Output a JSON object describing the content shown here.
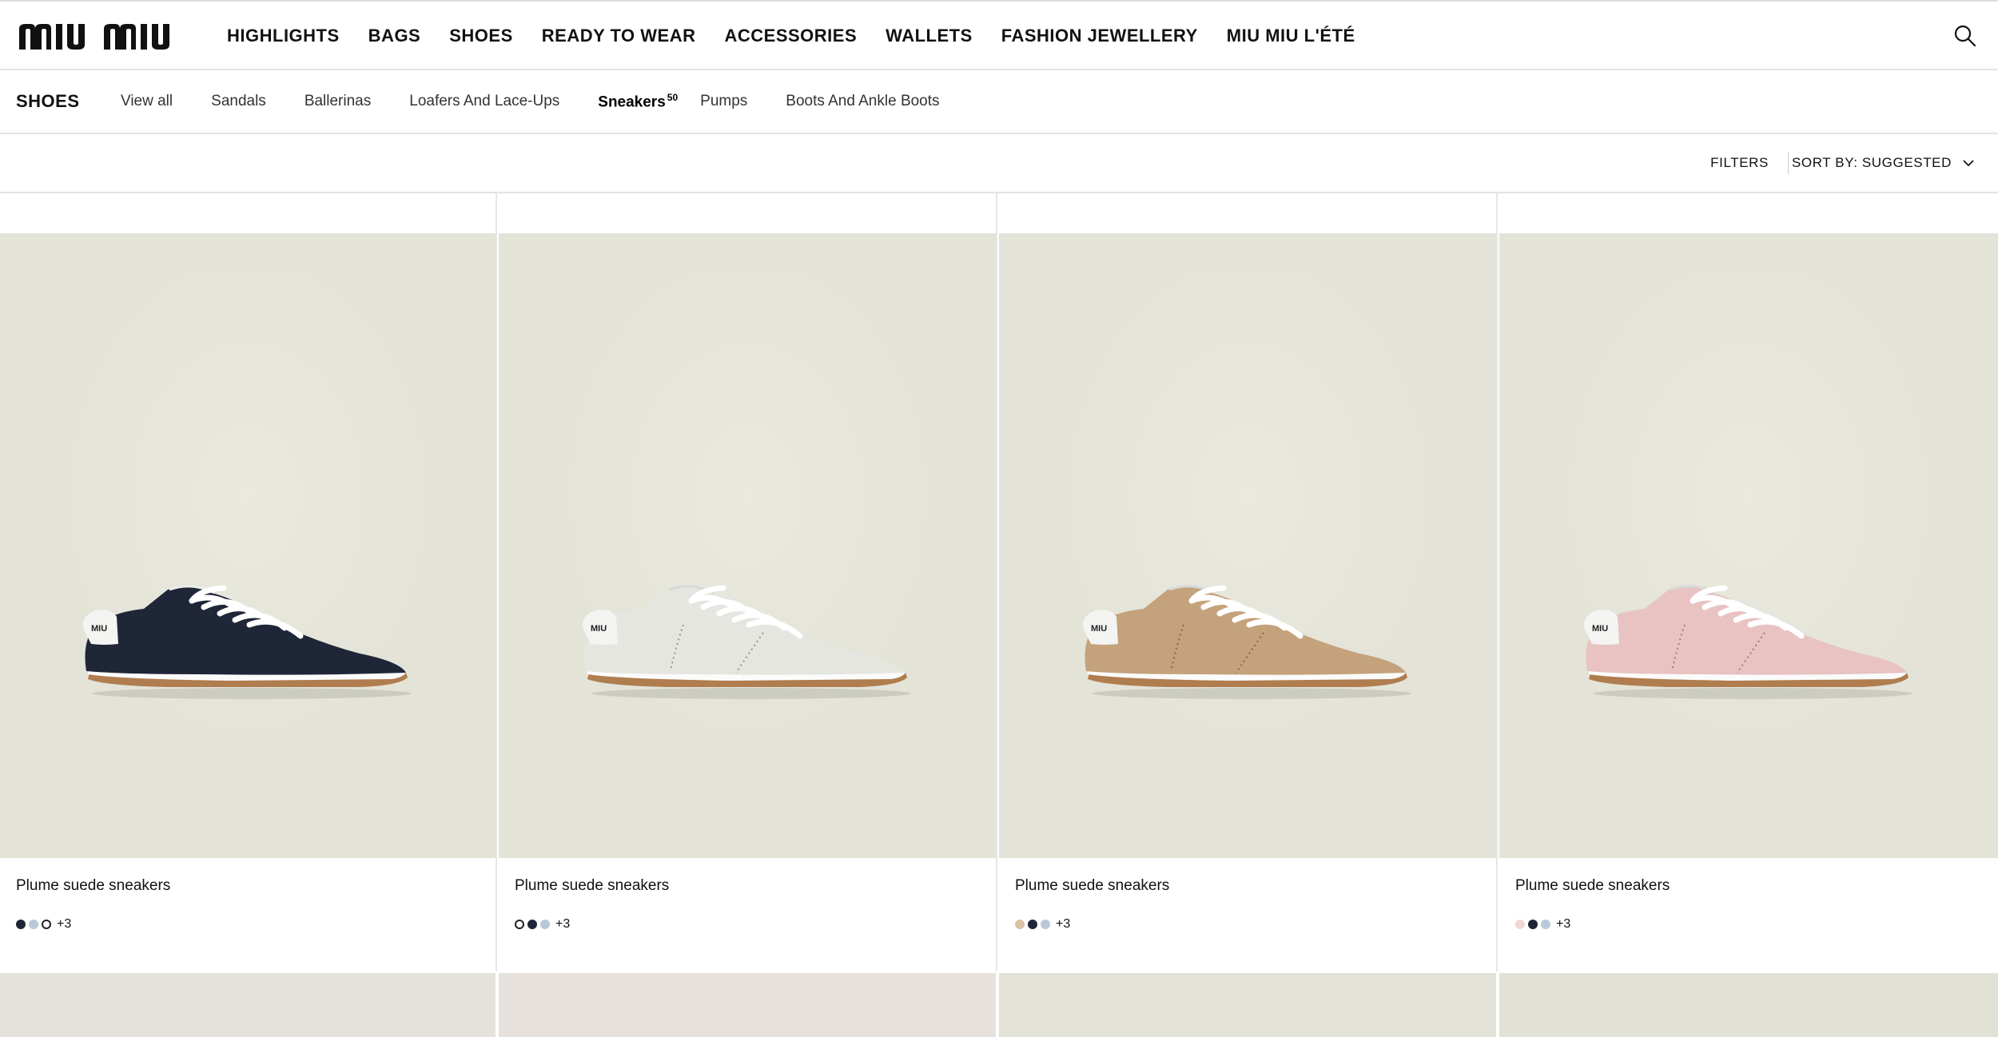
{
  "header": {
    "logo_text": "MIU MIU",
    "nav": [
      "HIGHLIGHTS",
      "BAGS",
      "SHOES",
      "READY TO WEAR",
      "ACCESSORIES",
      "WALLETS",
      "FASHION JEWELLERY",
      "MIU MIU L'ÉTÉ"
    ],
    "search_icon": "search-icon"
  },
  "subnav": {
    "title": "SHOES",
    "items": [
      "View all",
      "Sandals",
      "Ballerinas",
      "Loafers And Lace-Ups",
      "Sneakers",
      "Pumps",
      "Boots And Ankle Boots"
    ],
    "active_item": "Sneakers",
    "active_count": "50"
  },
  "toolbar": {
    "filters_label": "FILTERS",
    "sort_label": "SORT BY: SUGGESTED"
  },
  "products": [
    {
      "name": "Plume suede sneakers",
      "more": "+3",
      "shoe_color": "#1f2638",
      "swatches": [
        "#1f2638",
        "#b9c9d6",
        "ring"
      ]
    },
    {
      "name": "Plume suede sneakers",
      "more": "+3",
      "shoe_color": "#e4e6df",
      "swatches": [
        "ring",
        "#1f2638",
        "#b9c9d6"
      ]
    },
    {
      "name": "Plume suede sneakers",
      "more": "+3",
      "shoe_color": "#c4a27b",
      "swatches": [
        "#d9c2a5",
        "#1f2638",
        "#b9c9d6"
      ]
    },
    {
      "name": "Plume suede sneakers",
      "more": "+3",
      "shoe_color": "#e8c3c2",
      "swatches": [
        "#f1d7d6",
        "#1f2638",
        "#b9c9d6"
      ]
    }
  ],
  "next_row_colors": [
    "#e5e2db",
    "#e6e1dd",
    "#e2e2d7",
    "#e1e1d6"
  ]
}
